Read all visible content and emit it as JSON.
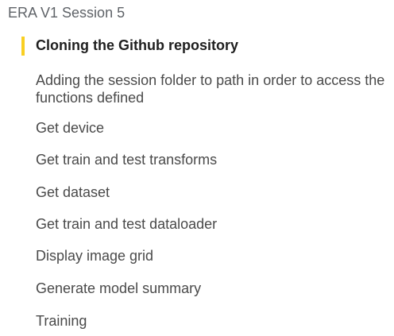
{
  "toc": {
    "title": "ERA V1 Session 5",
    "accent_color": "#f9cf22",
    "items": [
      {
        "label": "Cloning the Github repository",
        "active": true
      },
      {
        "label": "Adding the session folder to path in order to access the functions defined"
      },
      {
        "label": "Get device"
      },
      {
        "label": "Get train and test transforms"
      },
      {
        "label": "Get dataset"
      },
      {
        "label": "Get train and test dataloader"
      },
      {
        "label": "Display image grid"
      },
      {
        "label": "Generate model summary"
      },
      {
        "label": "Training"
      }
    ]
  }
}
